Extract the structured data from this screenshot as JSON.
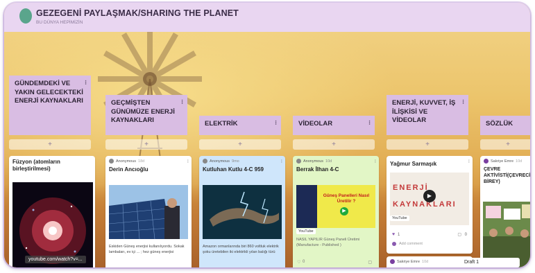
{
  "header": {
    "title": "GEZEGENİ PAYLAŞMAK/SHARING THE PLANET",
    "subtitle": "BU DÜNYA HEPİMİZİN"
  },
  "columns": [
    {
      "title": "GÜNDEMDEKİ VE YAKIN GELECEKTEKİ ENERJİ KAYNAKLARI",
      "add": "+"
    },
    {
      "title": "GEÇMİŞTEN GÜNÜMÜZE ENERJİ KAYNAKLARI",
      "add": "+"
    },
    {
      "title": "ELEKTRİK",
      "add": "+"
    },
    {
      "title": "VİDEOLAR",
      "add": "+"
    },
    {
      "title": "ENERJİ, KUVVET, İŞ İLİŞKİSİ VE VİDEOLAR",
      "add": "+"
    },
    {
      "title": "SÖZLÜK",
      "add": "+"
    }
  ],
  "cards": {
    "c1": {
      "title": "Füzyon (atomların birleştirilmesi)"
    },
    "c2": {
      "author": "Anonymous",
      "time": "18d",
      "title": "Derin Ancıoğlu",
      "text": "Eskiden Güneş enerjisi kullanılıyordu. Sokak lambaları, ev içi ... ; hez güneş enerjisi"
    },
    "c3": {
      "author": "Anonymous",
      "time": "9mo",
      "title": "Kutluhan Kutlu 4-C 959",
      "text": "Amazon ormanlarında biri 860 voltluk elektrik şoku üretebilen iki elektrikli yılan balığı türü"
    },
    "c4": {
      "author": "Anonymous",
      "time": "10d",
      "title": "Berrak İlhan 4-C",
      "thumb_text": "Güneş Panelleri Nasıl Üretilir ?",
      "badge": "YouTube",
      "text": "NASIL YAPILIR Güneş Paneli Üretimi (Manufacture - Published )",
      "count": "0"
    },
    "c5": {
      "title": "Yağmur Sarmaşık",
      "thumb_text": "ENERJİ KAYNAKLARI",
      "badge": "YouTube",
      "likes": "1",
      "comments": "0",
      "add_comment": "Add comment"
    },
    "c5b": {
      "author": "Sakriye Emre",
      "time": "10d"
    },
    "c6": {
      "author": "Sakriye Emre",
      "time": "10d",
      "title": "ÇEVRE AKTİVİSTİ(ÇEVRECİ BİREY)"
    }
  },
  "statusbar": "youtube.com/watch?v=...",
  "draft": "Draft 1"
}
